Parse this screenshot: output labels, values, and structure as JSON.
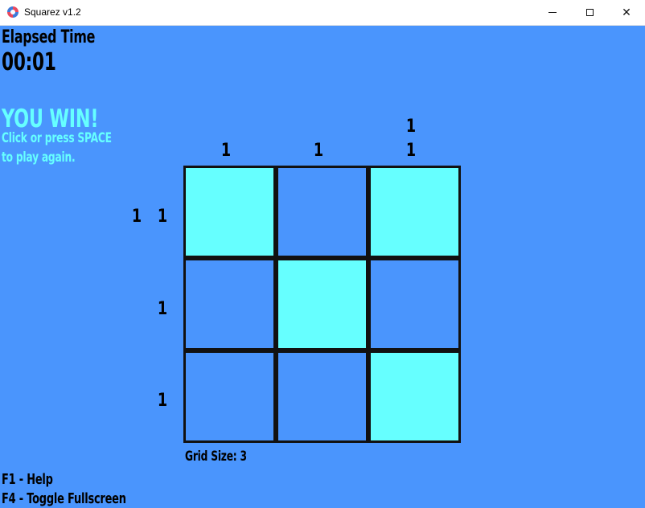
{
  "window": {
    "title": "Squarez v1.2",
    "minimize_label": "",
    "close_label": "✕"
  },
  "hud": {
    "elapsed_label": "Elapsed Time",
    "elapsed_value": "00:01"
  },
  "status": {
    "message": "YOU WIN!",
    "sub_line_1": "Click or press SPACE",
    "sub_line_2": "to play again."
  },
  "grid": {
    "size_label": "Grid Size: 3",
    "size": 3,
    "cells": [
      [
        true,
        false,
        true
      ],
      [
        false,
        true,
        false
      ],
      [
        false,
        false,
        true
      ]
    ],
    "column_clues": [
      [
        "1"
      ],
      [
        "1"
      ],
      [
        "1",
        "1"
      ]
    ],
    "row_clues": [
      [
        "1",
        "1"
      ],
      [
        "1"
      ],
      [
        "1"
      ]
    ]
  },
  "help": {
    "line_1": "F1 - Help",
    "line_2": "F4 - Toggle Fullscreen"
  },
  "colors": {
    "background": "#4a95fd",
    "filled": "#66ffff",
    "grid_line": "#111111",
    "win_text": "#66ffff"
  }
}
